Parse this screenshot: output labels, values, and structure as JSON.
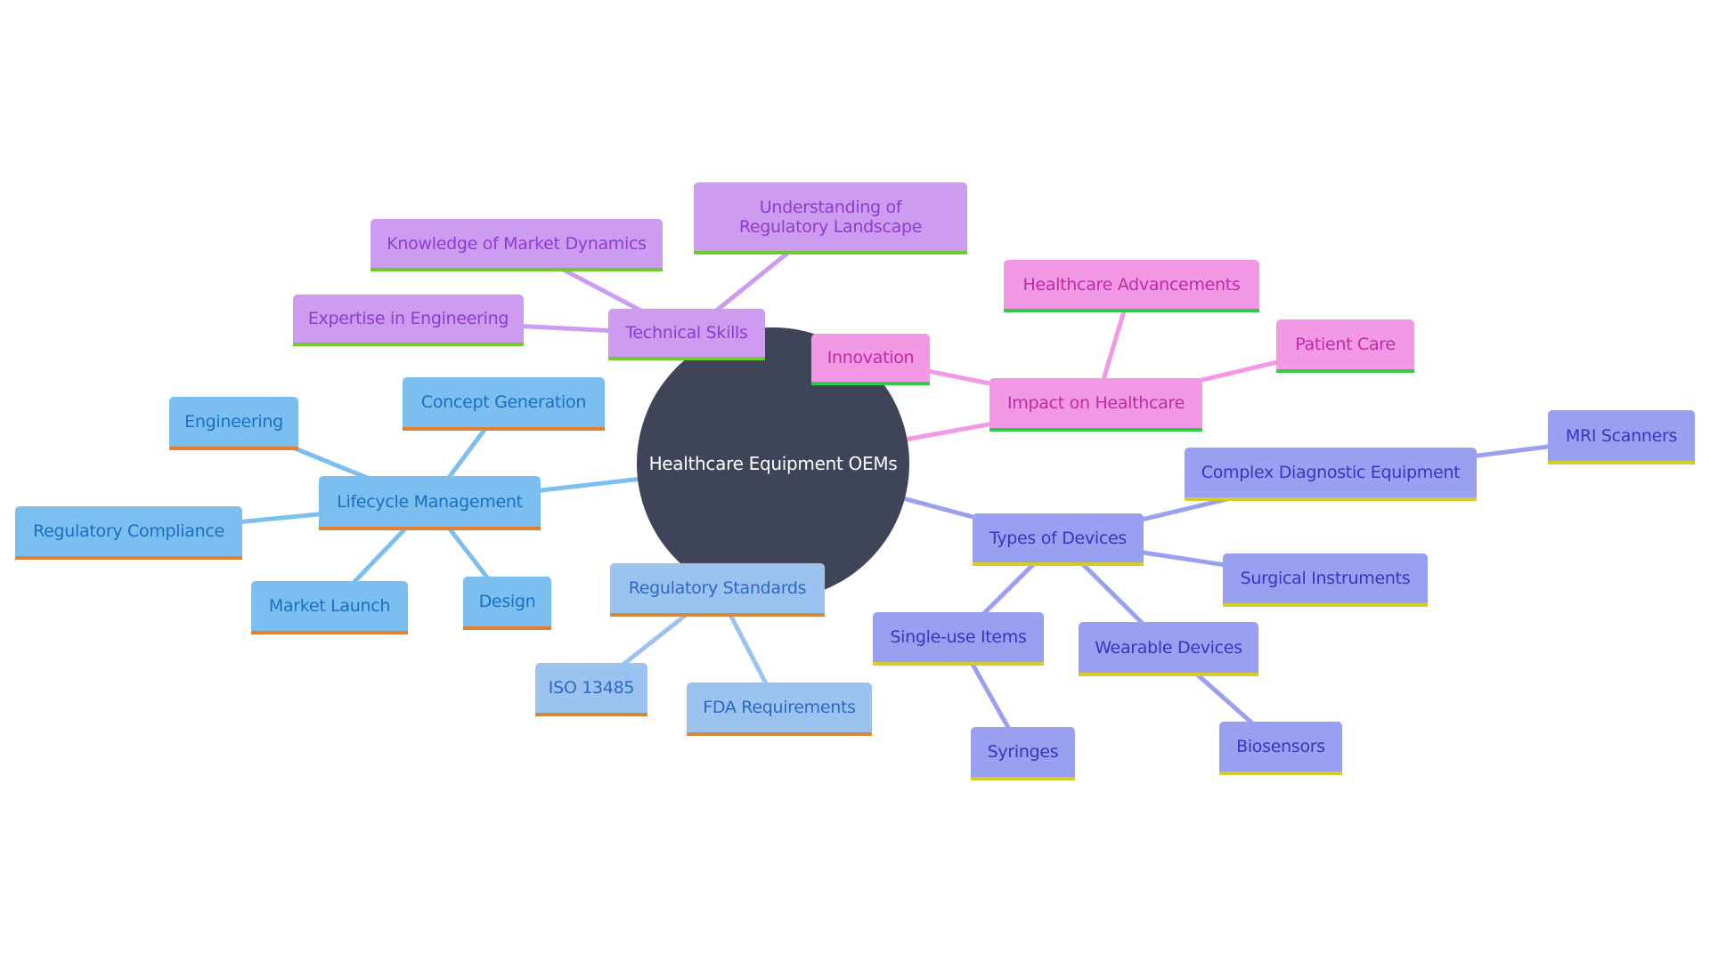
{
  "diagram": {
    "type": "mindmap",
    "root": {
      "id": "root",
      "label": "Healthcare Equipment OEMs",
      "color": "#404459"
    },
    "branches": [
      {
        "id": "technical-skills",
        "label": "Technical Skills",
        "theme": "tech",
        "colors": {
          "fill": "#cd9bf0",
          "text": "#8f3bd2",
          "underline": "#6ccc2c",
          "link": "#cd9bf0"
        },
        "children": [
          {
            "id": "knowledge-market",
            "label": "Knowledge of Market Dynamics"
          },
          {
            "id": "understanding-regulatory",
            "label": "Understanding of Regulatory Landscape"
          },
          {
            "id": "expertise-engineering",
            "label": "Expertise in Engineering"
          }
        ]
      },
      {
        "id": "impact-healthcare",
        "label": "Impact on Healthcare",
        "theme": "impact",
        "colors": {
          "fill": "#f398e4",
          "text": "#c12aa6",
          "underline": "#2ecb46",
          "link": "#f398e4"
        },
        "children": [
          {
            "id": "innovation",
            "label": "Innovation"
          },
          {
            "id": "healthcare-advancements",
            "label": "Healthcare Advancements"
          },
          {
            "id": "patient-care",
            "label": "Patient Care"
          }
        ]
      },
      {
        "id": "types-devices",
        "label": "Types of Devices",
        "theme": "devices",
        "colors": {
          "fill": "#9aa0f0",
          "text": "#3337c2",
          "underline": "#d6cc28",
          "link": "#9aa0f0"
        },
        "children": [
          {
            "id": "complex-diagnostic",
            "label": "Complex Diagnostic Equipment",
            "children": [
              {
                "id": "mri-scanners",
                "label": "MRI Scanners"
              }
            ]
          },
          {
            "id": "surgical-instruments",
            "label": "Surgical Instruments"
          },
          {
            "id": "single-use",
            "label": "Single-use Items",
            "children": [
              {
                "id": "syringes",
                "label": "Syringes"
              }
            ]
          },
          {
            "id": "wearable-devices",
            "label": "Wearable Devices",
            "children": [
              {
                "id": "biosensors",
                "label": "Biosensors"
              }
            ]
          }
        ]
      },
      {
        "id": "regulatory-standards",
        "label": "Regulatory Standards",
        "theme": "regstd",
        "colors": {
          "fill": "#9cc3f0",
          "text": "#2a69c6",
          "underline": "#d4893a",
          "link": "#9cc3f0"
        },
        "children": [
          {
            "id": "iso-13485",
            "label": "ISO 13485"
          },
          {
            "id": "fda-requirements",
            "label": "FDA Requirements"
          }
        ]
      },
      {
        "id": "lifecycle-management",
        "label": "Lifecycle Management",
        "theme": "lifecycle",
        "colors": {
          "fill": "#7bbff0",
          "text": "#1b6fc2",
          "underline": "#e3802f",
          "link": "#7bbff0"
        },
        "children": [
          {
            "id": "concept-generation",
            "label": "Concept Generation"
          },
          {
            "id": "engineering",
            "label": "Engineering"
          },
          {
            "id": "regulatory-compliance",
            "label": "Regulatory Compliance"
          },
          {
            "id": "market-launch",
            "label": "Market Launch"
          },
          {
            "id": "design",
            "label": "Design"
          }
        ]
      }
    ]
  },
  "labels": {
    "root": "Healthcare Equipment OEMs",
    "technical_skills": "Technical Skills",
    "knowledge_market": "Knowledge of Market Dynamics",
    "understanding_regulatory": "Understanding of Regulatory Landscape",
    "expertise_engineering": "Expertise in Engineering",
    "impact_healthcare": "Impact on Healthcare",
    "innovation": "Innovation",
    "healthcare_advancements": "Healthcare Advancements",
    "patient_care": "Patient Care",
    "types_devices": "Types of Devices",
    "complex_diagnostic": "Complex Diagnostic Equipment",
    "mri_scanners": "MRI Scanners",
    "surgical_instruments": "Surgical Instruments",
    "single_use": "Single-use Items",
    "syringes": "Syringes",
    "wearable_devices": "Wearable Devices",
    "biosensors": "Biosensors",
    "regulatory_standards": "Regulatory Standards",
    "iso_13485": "ISO 13485",
    "fda_requirements": "FDA Requirements",
    "lifecycle_management": "Lifecycle Management",
    "concept_generation": "Concept Generation",
    "engineering": "Engineering",
    "regulatory_compliance": "Regulatory Compliance",
    "market_launch": "Market Launch",
    "design": "Design"
  }
}
